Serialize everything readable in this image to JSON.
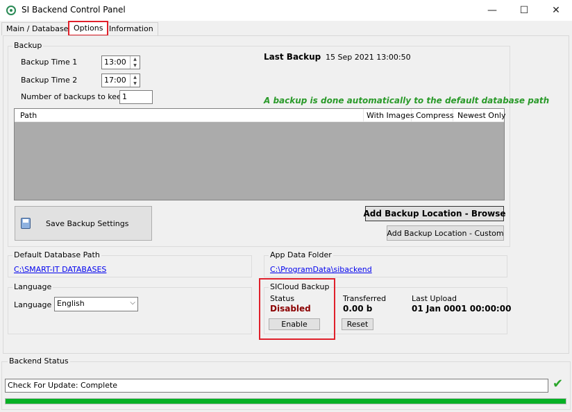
{
  "window": {
    "title": "SI Backend Control Panel",
    "minimize_glyph": "—",
    "maximize_glyph": "☐",
    "close_glyph": "✕"
  },
  "tabs": [
    {
      "label": "Main / Databases"
    },
    {
      "label": "Options"
    },
    {
      "label": "Information"
    }
  ],
  "backup": {
    "group_label": "Backup",
    "time1_label": "Backup Time 1",
    "time1_value": "13:00",
    "time2_label": "Backup Time 2",
    "time2_value": "17:00",
    "keep_label": "Number of backups to keep",
    "keep_value": "1",
    "last_backup_label": "Last Backup",
    "last_backup_value": "15 Sep 2021 13:00:50",
    "auto_note": "A backup is done automatically to the default database path",
    "columns": [
      "Path",
      "With Images",
      "Compress",
      "Newest Only"
    ],
    "save_button": "Save Backup Settings",
    "add_browse_button": "Add Backup Location - Browse",
    "add_custom_button": "Add Backup Location - Custom"
  },
  "default_db": {
    "group_label": "Default Database Path",
    "path": "C:\\SMART-IT DATABASES"
  },
  "app_data": {
    "group_label": "App Data Folder",
    "path": "C:\\ProgramData\\sibackend"
  },
  "language": {
    "group_label": "Language",
    "label": "Language",
    "selected": "English"
  },
  "sicloud": {
    "group_label": "SICloud Backup",
    "status_label": "Status",
    "status_value": "Disabled",
    "enable_button": "Enable",
    "transferred_label": "Transferred",
    "transferred_value": "0.00 b",
    "reset_button": "Reset",
    "last_upload_label": "Last Upload",
    "last_upload_value": "01 Jan 0001 00:00:00"
  },
  "backend_status": {
    "group_label": "Backend Status",
    "message": "Check For Update: Complete",
    "progress": 1.0
  },
  "colors": {
    "accent_green": "#2a9a2a",
    "status_red": "#8b0000",
    "highlight_red": "#e0202a",
    "progress_green": "#06b025"
  }
}
